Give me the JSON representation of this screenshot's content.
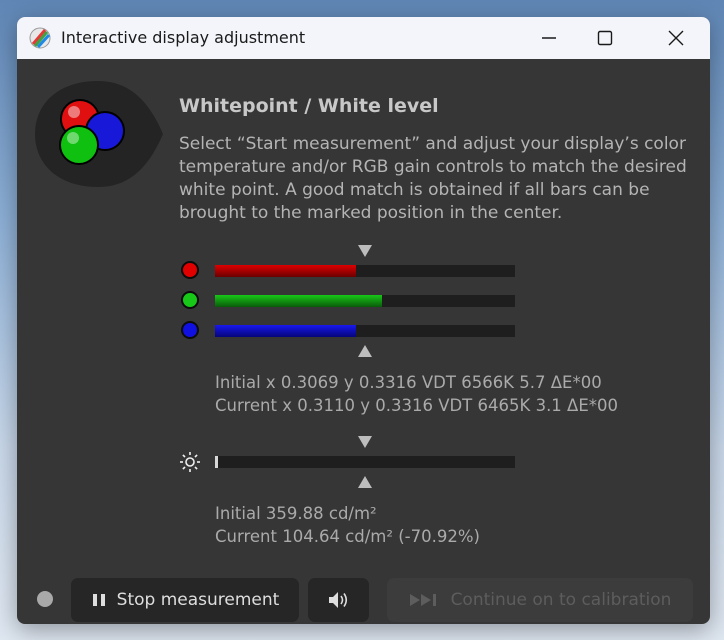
{
  "window": {
    "title": "Interactive display adjustment"
  },
  "main": {
    "heading": "Whitepoint / White level",
    "description": "Select “Start measurement” and adjust your display’s color temperature and/or RGB gain controls to match the desired white point. A good match is obtained if all bars can be brought to the marked position in the center.",
    "rgb_bars": [
      {
        "channel": "red",
        "color": "#e00000",
        "level": 0.47
      },
      {
        "channel": "green",
        "color": "#18c818",
        "level": 0.555
      },
      {
        "channel": "blue",
        "color": "#1010e0",
        "level": 0.47
      }
    ],
    "whitepoint_initial": "Initial x 0.3069 y 0.3316 VDT 6566K 5.7 ΔE*00",
    "whitepoint_current": "Current x 0.3110 y 0.3316 VDT 6465K 3.1 ΔE*00",
    "luminance_bar_level": 0.01,
    "luminance_initial": "Initial 359.88 cd/m²",
    "luminance_current": "Current 104.64 cd/m² (-70.92%)"
  },
  "footer": {
    "stop_label": "Stop measurement",
    "continue_label": "Continue on to calibration"
  },
  "icons": [
    "app-icon",
    "minimize-icon",
    "maximize-icon",
    "close-icon",
    "rgb-logo-icon",
    "brightness-icon",
    "pause-icon",
    "speaker-icon",
    "skip-forward-icon"
  ]
}
